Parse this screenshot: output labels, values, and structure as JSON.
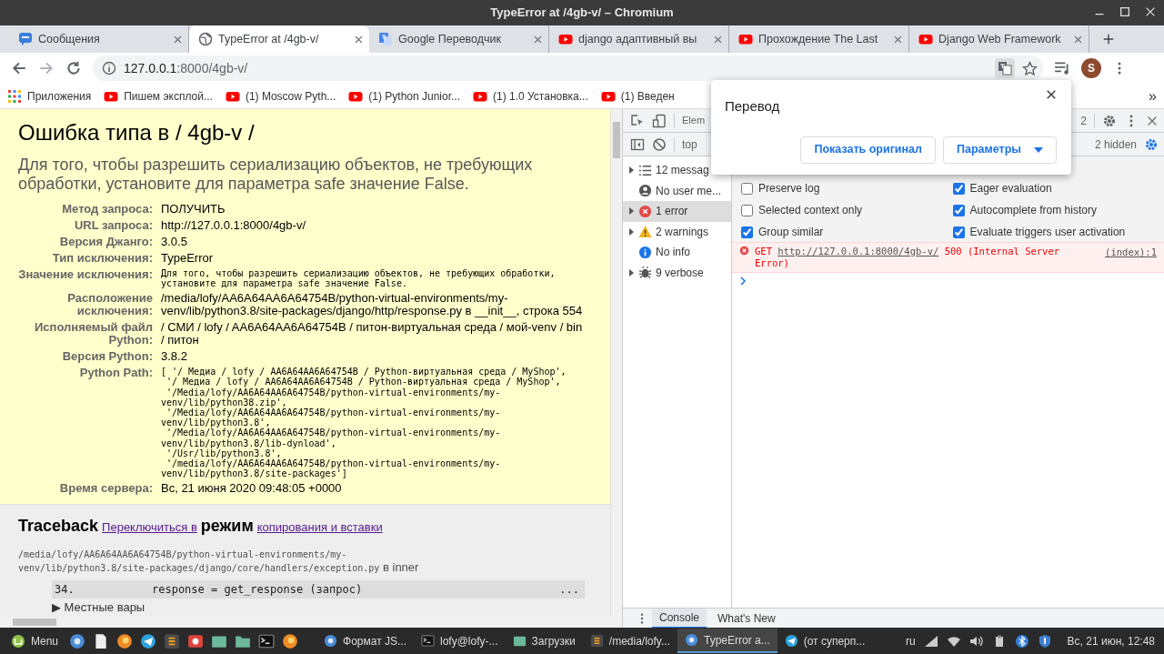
{
  "window": {
    "title": "TypeError at /4gb-v/ – Chromium"
  },
  "tabs": [
    {
      "label": "Сообщения",
      "kind": "chat",
      "selected": false
    },
    {
      "label": "TypeError at /4gb-v/",
      "kind": "globe",
      "selected": true
    },
    {
      "label": "Google Переводчик",
      "kind": "translate",
      "selected": false
    },
    {
      "label": "django адаптивный вы",
      "kind": "video",
      "selected": false
    },
    {
      "label": "Прохождение The Last",
      "kind": "video",
      "selected": false
    },
    {
      "label": "Django Web Framework",
      "kind": "video",
      "selected": false
    }
  ],
  "address_bar": {
    "host": "127.0.0.1",
    "path": ":8000/4gb-v/",
    "avatar_letter": "S"
  },
  "bookmarks": [
    {
      "label": "Приложения",
      "kind": "apps"
    },
    {
      "label": "Пишем эксплой...",
      "kind": "video"
    },
    {
      "label": "(1) Moscow Pyth...",
      "kind": "video"
    },
    {
      "label": "(1) Python Junior...",
      "kind": "video"
    },
    {
      "label": "(1) 1.0 Установка...",
      "kind": "video"
    },
    {
      "label": "(1) Введен",
      "kind": "video"
    }
  ],
  "bookmarks_more": "»",
  "page": {
    "title": "Ошибка типа в / 4gb-v /",
    "subtitle": "Для того, чтобы разрешить сериализацию объектов, не требующих обработки, установите для параметра safe значение False.",
    "meta": [
      {
        "label": "Метод запроса:",
        "kind": "text",
        "value": "ПОЛУЧИТЬ"
      },
      {
        "label": "URL запроса:",
        "kind": "text",
        "value": "http://127.0.0.1:8000/4gb-v/"
      },
      {
        "label": "Версия Джанго:",
        "kind": "text",
        "value": "3.0.5"
      },
      {
        "label": "Тип исключения:",
        "kind": "text",
        "value": "TypeError"
      },
      {
        "label": "Значение исключения:",
        "kind": "code",
        "lines": [
          "Для того, чтобы разрешить сериализацию объектов, не требующих обработки,",
          "установите для параметра safe значение False."
        ]
      },
      {
        "label": "Расположение исключения:",
        "kind": "text",
        "value": "/media/lofy/AA6A64AA6A64754B/python-virtual-environments/my-venv/lib/python3.8/site-packages/django/http/response.py в __init__, строка 554"
      },
      {
        "label": "Исполняемый файл Python:",
        "kind": "text",
        "value": "/ СМИ / lofy / AA6A64AA6A64754B / питон-виртуальная среда / мой-venv / bin / питон"
      },
      {
        "label": "Версия Python:",
        "kind": "text",
        "value": "3.8.2"
      },
      {
        "label": "Python Path:",
        "kind": "code",
        "lines": [
          "[ '/ Медиа / lofy / AA6A64AA6A64754B / Python-виртуальная среда / MyShop',",
          " '/ Медиа / lofy / AA6A64AA6A64754B / Python-виртуальная среда / MyShop',",
          " '/Media/lofy/AA6A64AA6A64754B/python-virtual-environments/my-",
          "venv/lib/python38.zip',",
          " '/Media/lofy/AA6A64AA6A64754B/python-virtual-environments/my-",
          "venv/lib/python3.8',",
          " '/Media/lofy/AA6A64AA6A64754B/python-virtual-environments/my-",
          "venv/lib/python3.8/lib-dynload',",
          " '/Usr/lib/python3.8',",
          " '/media/lofy/AA6A64AA6A64754B/python-virtual-environments/my-",
          "venv/lib/python3.8/site-packages']"
        ]
      },
      {
        "label": "Время сервера:",
        "kind": "text",
        "value": "Вс, 21 июня 2020 09:48:05 +0000"
      }
    ],
    "traceback": {
      "heading": "Traceback",
      "switch_link": "Переключиться в",
      "mode_word": "режим",
      "copy_link": "копирования и вставки",
      "file_path": "/media/lofy/AA6A64AA6A64754B/python-virtual-environments/my-venv/lib/python3.8/site-packages/django/core/handlers/exception.py",
      "file_suffix": "в inner",
      "line_number": "34.",
      "code": "response = get_response (запрос)",
      "more": "...",
      "local_vars_marker": "▶",
      "local_vars": "Местные вары"
    }
  },
  "devtools": {
    "elements_tab": "Elem",
    "issues_count": "2",
    "context": "top",
    "hidden_count": "2 hidden",
    "sidebar": [
      {
        "label": "12 messag",
        "kind": "list",
        "expandable": true,
        "selected": false
      },
      {
        "label": "No user me...",
        "kind": "user",
        "expandable": false,
        "selected": false
      },
      {
        "label": "1 error",
        "kind": "error",
        "expandable": true,
        "selected": true
      },
      {
        "label": "2 warnings",
        "kind": "warning",
        "expandable": true,
        "selected": false
      },
      {
        "label": "No info",
        "kind": "info",
        "expandable": false,
        "selected": false
      },
      {
        "label": "9 verbose",
        "kind": "verbose",
        "expandable": true,
        "selected": false
      }
    ],
    "settings": [
      {
        "label": "Preserve log",
        "checked": false
      },
      {
        "label": "Eager evaluation",
        "checked": true
      },
      {
        "label": "Selected context only",
        "checked": false
      },
      {
        "label": "Autocomplete from history",
        "checked": true
      },
      {
        "label": "Group similar",
        "checked": true
      },
      {
        "label": "Evaluate triggers user activation",
        "checked": true
      }
    ],
    "error": {
      "method": "GET",
      "url": "http://127.0.0.1:8000/4gb-v/",
      "status": "500 (Internal Server Error)",
      "source": "(index):1"
    },
    "drawer_tabs": [
      {
        "label": "Console",
        "selected": true
      },
      {
        "label": "What's New",
        "selected": false
      }
    ]
  },
  "translate_popup": {
    "title": "Перевод",
    "buttons": [
      {
        "label": "Показать оригинал",
        "kind": "plain"
      },
      {
        "label": "Параметры",
        "kind": "dropdown"
      }
    ]
  },
  "taskbar": {
    "menu": "Menu",
    "tasks": [
      {
        "label": "Формат JS...",
        "kind": "browser",
        "selected": false
      },
      {
        "label": "lofy@lofy-...",
        "kind": "terminal",
        "selected": false
      },
      {
        "label": "Загрузки",
        "kind": "folder",
        "selected": false
      },
      {
        "label": "/media/lofy...",
        "kind": "editor",
        "selected": false
      },
      {
        "label": "TypeError a...",
        "kind": "browser",
        "selected": true
      },
      {
        "label": "(от суперп...",
        "kind": "plane",
        "selected": false
      }
    ],
    "language": "ru",
    "clock": "Вс, 21 июн, 12:48"
  }
}
